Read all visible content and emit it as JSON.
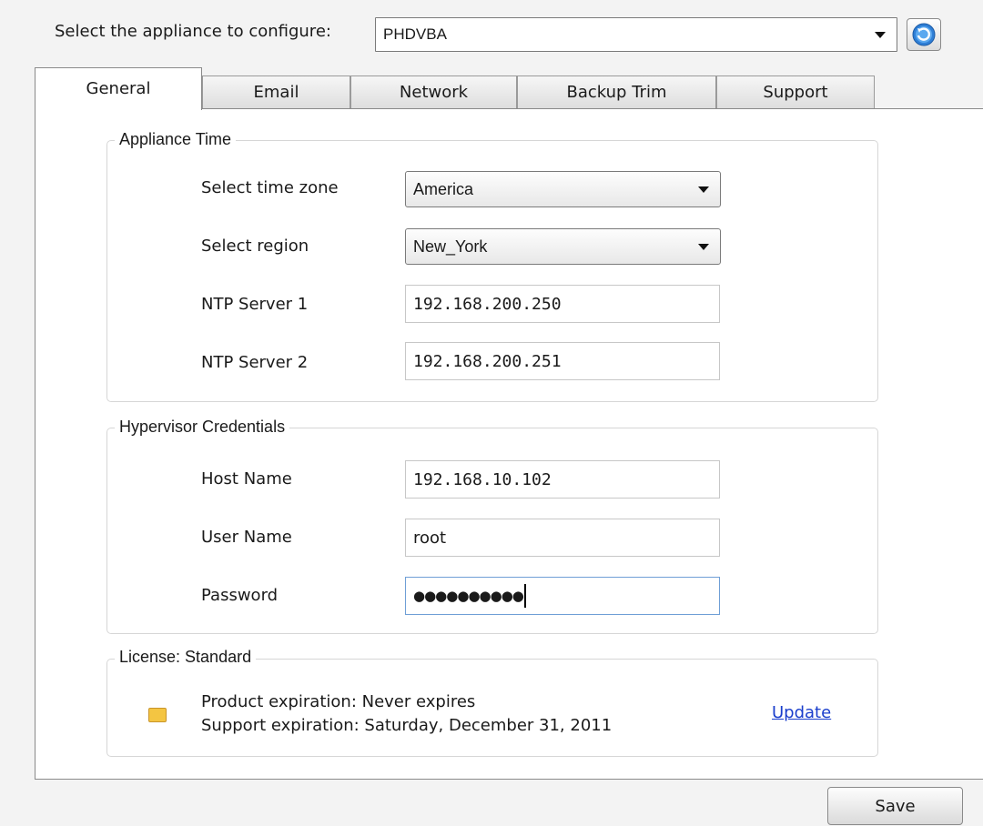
{
  "appliance": {
    "label": "Select the appliance to configure:",
    "selected": "PHDVBA"
  },
  "tabs": [
    {
      "label": "General",
      "active": true
    },
    {
      "label": "Email"
    },
    {
      "label": "Network"
    },
    {
      "label": "Backup Trim"
    },
    {
      "label": "Support"
    }
  ],
  "appliance_time": {
    "title": "Appliance Time",
    "timezone_label": "Select time zone",
    "timezone_value": "America",
    "region_label": "Select region",
    "region_value": "New_York",
    "ntp1_label": "NTP Server 1",
    "ntp1_value": "192.168.200.250",
    "ntp2_label": "NTP Server 2",
    "ntp2_value": "192.168.200.251"
  },
  "hypervisor": {
    "title": "Hypervisor Credentials",
    "host_label": "Host Name",
    "host_value": "192.168.10.102",
    "user_label": "User Name",
    "user_value": "root",
    "password_label": "Password",
    "password_value": "●●●●●●●●●●"
  },
  "license": {
    "title": "License: Standard",
    "product_expiration": "Product expiration: Never expires",
    "support_expiration": "Support expiration: Saturday, December 31, 2011",
    "update_link": "Update"
  },
  "footer": {
    "save_label": "Save"
  },
  "icons": {
    "refresh": "refresh-icon",
    "license": "license-key-icon"
  },
  "colors": {
    "link": "#1a3ecc",
    "license_icon": "#f4c542",
    "refresh_blue": "#2f7fd6"
  }
}
